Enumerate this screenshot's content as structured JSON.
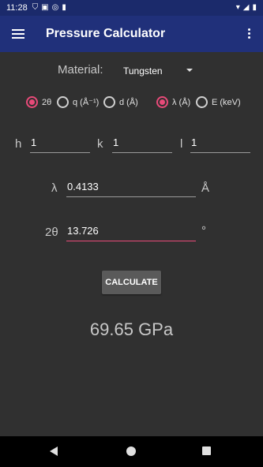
{
  "status_bar": {
    "time": "11:28",
    "notification_icons": [
      "shield-icon",
      "a-icon",
      "at-icon",
      "sd-card-icon"
    ],
    "system_icons": [
      "wifi-icon",
      "signal-icon",
      "battery-icon"
    ]
  },
  "app_bar": {
    "title": "Pressure Calculator"
  },
  "material": {
    "label": "Material:",
    "selected": "Tungsten"
  },
  "radios": {
    "two_theta": "2θ",
    "q": "q (Å⁻¹)",
    "d": "d (Å)",
    "lambda": "λ (Å)",
    "energy": "E (keV)"
  },
  "miller": {
    "h_label": "h",
    "h_value": "1",
    "k_label": "k",
    "k_value": "1",
    "l_label": "l",
    "l_value": "1"
  },
  "wavelength": {
    "label": "λ",
    "value": "0.4133",
    "unit": "Å"
  },
  "angle": {
    "label": "2θ",
    "value": "13.726",
    "unit": "°"
  },
  "calculate_label": "CALCULATE",
  "result": "69.65 GPa",
  "colors": {
    "accent": "#e84a79",
    "app_bar": "#20307a",
    "status_bar": "#1b2a6b",
    "background": "#303030"
  }
}
